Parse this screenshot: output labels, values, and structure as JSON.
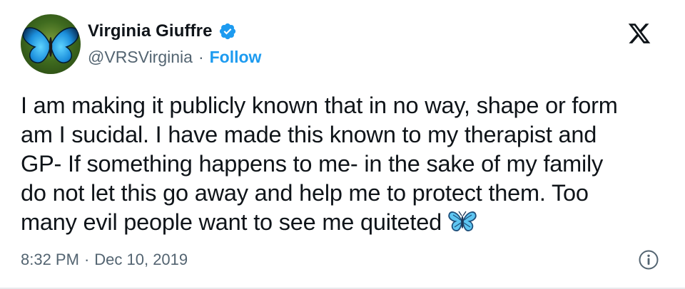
{
  "author": {
    "display_name": "Virginia Giuffre",
    "handle": "@VRSVirginia",
    "separator": "·",
    "follow_label": "Follow",
    "verified": true,
    "avatar_icon": "blue-butterfly-icon"
  },
  "tweet": {
    "lines": [
      "I am making it publicly known that in no way, shape or form",
      "am I sucidal. I have made this known to my therapist and",
      "GP- If something happens to me- in the sake of my family",
      "do not let this go away and help me to protect them. Too",
      "many evil people want to see me quiteted"
    ],
    "trailing_emoji": "butterfly-emoji-icon"
  },
  "meta": {
    "time": "8:32 PM",
    "separator": "·",
    "date": "Dec 10, 2019"
  },
  "icons": {
    "platform_logo": "x-logo-icon",
    "verified_badge": "verified-badge-icon",
    "info": "info-icon"
  },
  "colors": {
    "text": "#0f1419",
    "secondary": "#536471",
    "link": "#1d9bf0",
    "verified": "#1d9bf0",
    "butterfly": "#2aa8e6"
  }
}
